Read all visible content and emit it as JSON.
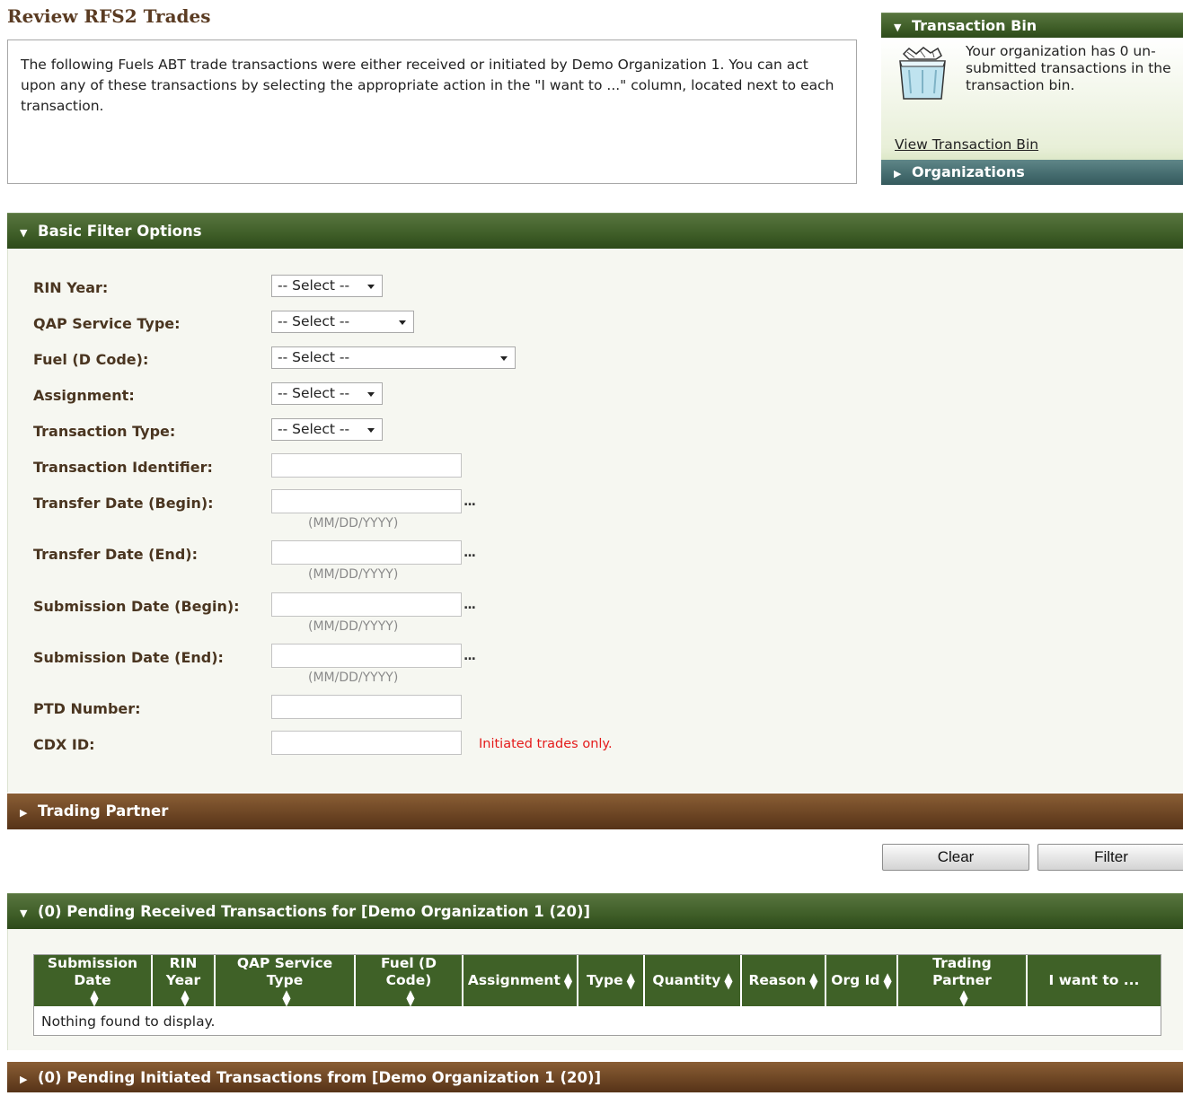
{
  "page": {
    "title": "Review RFS2 Trades",
    "intro": "The following Fuels ABT trade transactions were either received or initiated by Demo Organization 1. You can act upon any of these transactions by selecting the appropriate action in the \"I want to ...\" column, located next to each transaction."
  },
  "sidebar": {
    "bin_header": "Transaction Bin",
    "bin_message": "Your organization has 0 un-submitted transactions in the transaction bin.",
    "bin_link": "View Transaction Bin",
    "organizations_header": "Organizations"
  },
  "filter": {
    "header": "Basic Filter Options",
    "fields": {
      "rin_year": {
        "label": "RIN Year:",
        "value": "-- Select --"
      },
      "qap_service_type": {
        "label": "QAP Service Type:",
        "value": "-- Select --"
      },
      "fuel_d_code": {
        "label": "Fuel (D Code):",
        "value": "-- Select --"
      },
      "assignment": {
        "label": "Assignment:",
        "value": "-- Select --"
      },
      "transaction_type": {
        "label": "Transaction Type:",
        "value": "-- Select --"
      },
      "transaction_identifier": {
        "label": "Transaction Identifier:",
        "value": ""
      },
      "transfer_date_begin": {
        "label": "Transfer Date (Begin):",
        "value": "",
        "hint": "(MM/DD/YYYY)"
      },
      "transfer_date_end": {
        "label": "Transfer Date (End):",
        "value": "",
        "hint": "(MM/DD/YYYY)"
      },
      "submission_date_begin": {
        "label": "Submission Date (Begin):",
        "value": "",
        "hint": "(MM/DD/YYYY)"
      },
      "submission_date_end": {
        "label": "Submission Date (End):",
        "value": "",
        "hint": "(MM/DD/YYYY)"
      },
      "ptd_number": {
        "label": "PTD Number:",
        "value": ""
      },
      "cdx_id": {
        "label": "CDX ID:",
        "value": "",
        "note": "Initiated trades only."
      }
    },
    "picker_label": "...",
    "trading_partner_header": "Trading Partner",
    "clear_label": "Clear",
    "filter_label": "Filter"
  },
  "received": {
    "header": "(0) Pending Received Transactions for [Demo Organization 1 (20)]",
    "columns": [
      "Submission Date",
      "RIN Year",
      "QAP Service Type",
      "Fuel (D Code)",
      "Assignment",
      "Type",
      "Quantity",
      "Reason",
      "Org Id",
      "Trading Partner",
      "I want to ..."
    ],
    "empty_message": "Nothing found to display."
  },
  "initiated": {
    "header": "(0) Pending Initiated Transactions from [Demo Organization 1 (20)]"
  },
  "colors": {
    "green_header": "#3e5d27",
    "brown_header": "#6b4423",
    "slate_header": "#446b6e",
    "warning": "#e41b1b",
    "title": "#5a3b22"
  }
}
